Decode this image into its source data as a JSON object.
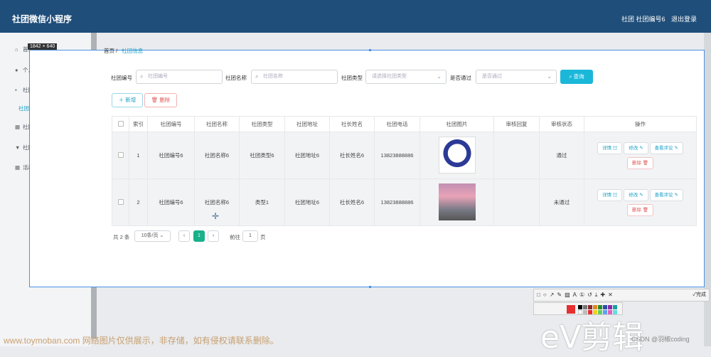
{
  "topbar": {
    "brand": "社团微信小程序",
    "user": "社团 社团编号6",
    "logout": "退出登录"
  },
  "sidebar": {
    "items": [
      {
        "label": "首页",
        "icon": "home-icon"
      },
      {
        "label": "个人中心",
        "icon": "user-icon"
      },
      {
        "label": "社团信息管理",
        "icon": "grid-icon"
      },
      {
        "label": "社团信息",
        "icon": ""
      },
      {
        "label": "社团申请管理",
        "icon": "grid-icon"
      },
      {
        "label": "社团活动管理",
        "icon": "trophy-icon"
      },
      {
        "label": "活动报名管理",
        "icon": "grid-icon"
      }
    ]
  },
  "selection_tag": "1842 × 640",
  "breadcrumb": {
    "home": "首页",
    "sep": "/",
    "current": "社团信息"
  },
  "filters": {
    "club_no_label": "社团编号",
    "club_no_placeholder": "社团编号",
    "club_name_label": "社团名称",
    "club_name_placeholder": "社团名称",
    "club_type_label": "社团类型",
    "club_type_placeholder": "请选择社团类型",
    "passed_label": "是否通过",
    "passed_placeholder": "是否通过",
    "search": "查询"
  },
  "actions": {
    "add": "新增",
    "delete": "删除"
  },
  "table": {
    "headers": [
      "索引",
      "社团编号",
      "社团名称",
      "社团类型",
      "社团地址",
      "社长姓名",
      "社团电话",
      "社团图片",
      "审核回复",
      "审核状态",
      "操作"
    ],
    "rows": [
      {
        "index": "1",
        "club_no": "社团编号6",
        "club_name": "社团名称6",
        "club_type": "社团类型6",
        "address": "社团地址6",
        "leader": "社长姓名6",
        "phone": "13823888886",
        "reply": "",
        "status": "通过"
      },
      {
        "index": "2",
        "club_no": "社团编号6",
        "club_name": "社团名称6",
        "club_type": "类型1",
        "address": "社团地址6",
        "leader": "社长姓名6",
        "phone": "13823888886",
        "reply": "",
        "status": "未通过"
      }
    ],
    "ops": {
      "detail": "详情",
      "edit": "修改",
      "comment": "查看评论",
      "delete": "删除"
    }
  },
  "pagination": {
    "total": "共 2 条",
    "page_size": "10条/页",
    "current": "1",
    "goto_label": "前往",
    "goto_value": "1",
    "page_unit": "页"
  },
  "toolbar": {
    "done": "完成"
  },
  "watermark": "www.toymoban.com 网络图片仅供展示，非存储，如有侵权请联系删除。",
  "ev_logo": "eV剪辑",
  "csdn": "CSDN @羽椒coding",
  "colors": {
    "topbar": "#1f4e7a",
    "accent": "#1aa0c7",
    "search": "#1ab7d9",
    "danger": "#e05a5a",
    "page_active": "#1ab08a"
  }
}
